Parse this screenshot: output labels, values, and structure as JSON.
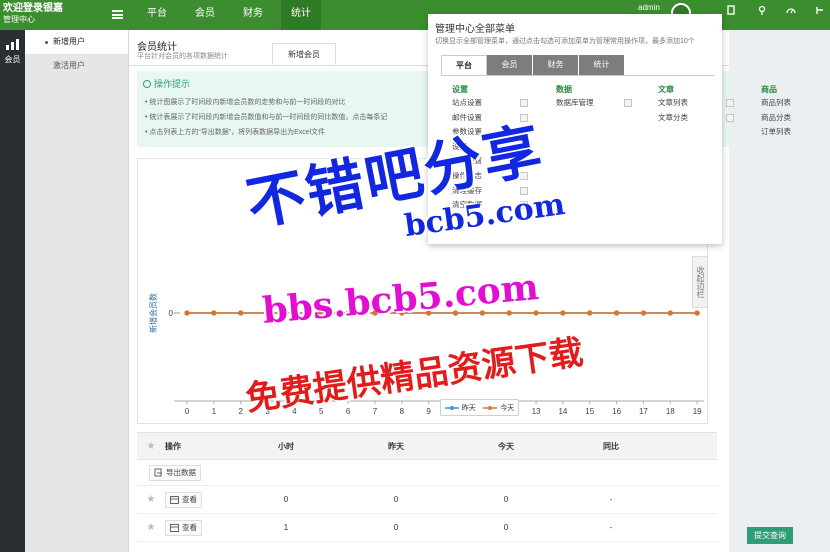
{
  "header": {
    "brand_line1": "欢迎登录银嘉",
    "brand_line2": "管理中心",
    "nav": [
      "平台",
      "会员",
      "财务",
      "统计"
    ],
    "active_nav": 3,
    "admin_name": "admin"
  },
  "rail": {
    "label": "会员"
  },
  "submenu": {
    "items": [
      "新增用户",
      "激活用户"
    ],
    "active": 0
  },
  "page": {
    "title": "会员统计",
    "subtitle": "平台针对会员的各项数据统计",
    "tab": "新增会员",
    "tips_title": "操作提示",
    "tips": [
      "统计图展示了时间段内新增会员数的走势和与前一时间段的对比",
      "统计表展示了时间段内新增会员数值和与前一时间段的同比数值，点击每条记",
      "点击列表上方的“导出数据”，将列表数据导出为Excel文件"
    ],
    "collapse_label": "收起边栏"
  },
  "chart_data": {
    "type": "line",
    "x": [
      0,
      1,
      2,
      3,
      4,
      5,
      6,
      7,
      8,
      9,
      10,
      11,
      12,
      13,
      14,
      15,
      16,
      17,
      18,
      19
    ],
    "series": [
      {
        "name": "昨天",
        "values": [
          0,
          0,
          0,
          0,
          0,
          0,
          0,
          0,
          0,
          0,
          0,
          0,
          0,
          0,
          0,
          0,
          0,
          0,
          0,
          0
        ],
        "color": "#2f9ad8"
      },
      {
        "name": "今天",
        "values": [
          0,
          0,
          0,
          0,
          0,
          0,
          0,
          0,
          0,
          0,
          0,
          0,
          0,
          0,
          0,
          0,
          0,
          0,
          0,
          0
        ],
        "color": "#e0732a"
      }
    ],
    "ylabel": "新增会员数",
    "yticks": [
      0
    ],
    "legend": "bottom-center"
  },
  "table": {
    "headers": [
      "操作",
      "小时",
      "昨天",
      "今天",
      "同比"
    ],
    "export_label": "导出数据",
    "rows": [
      {
        "action": "查看",
        "hour": "0",
        "yesterday": "0",
        "today": "0",
        "ratio": "-"
      },
      {
        "action": "查看",
        "hour": "1",
        "yesterday": "0",
        "today": "0",
        "ratio": "-"
      }
    ]
  },
  "submit_label": "提交查询",
  "popover": {
    "title": "管理中心全部菜单",
    "subtitle": "切换显示全部管理菜单，通过点击勾选可添加菜单为管理常用操作项，最多添加10个",
    "tabs": [
      "平台",
      "会员",
      "财务",
      "统计"
    ],
    "active_tab": 0,
    "columns": [
      {
        "head": "设置",
        "items": [
          "站点设置",
          "邮件设置",
          "参数设置",
          "设置",
          "权限设置",
          "操作日志",
          "清理缓存",
          "清空数据"
        ]
      },
      {
        "head": "数据",
        "items": [
          "数据库管理"
        ]
      },
      {
        "head": "文章",
        "items": [
          "文章列表",
          "文章分类"
        ]
      },
      {
        "head": "商品",
        "items": [
          "商品列表",
          "商品分类",
          "订单列表"
        ]
      }
    ]
  },
  "watermark": {
    "line1": "不错吧分享",
    "line2": "bcb5.com",
    "line3": "bbs.bcb5.com",
    "line4": "免费提供精品资源下载"
  }
}
